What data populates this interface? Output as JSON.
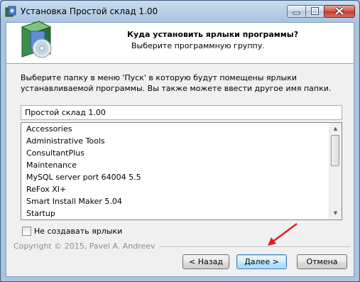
{
  "window": {
    "title": "Установка Простой склад 1.00"
  },
  "header": {
    "title": "Куда установить ярлыки программы?",
    "subtitle": "Выберите программную группу."
  },
  "description": "Выберите папку в меню 'Пуск' в которую будут помещены ярлыки устанавливаемой программы. Вы также можете ввести другое имя папки.",
  "folder_input": {
    "value": "Простой склад 1.00"
  },
  "folders": [
    "Accessories",
    "Administrative Tools",
    "ConsultantPlus",
    "Maintenance",
    "MySQL server port 64004 5.5",
    "ReFox XI+",
    "Smart Install Maker 5.04",
    "Startup"
  ],
  "no_shortcuts": {
    "label": "Не создавать ярлыки",
    "checked": false
  },
  "copyright": "Copyright © 2015, Pavel A. Andreev",
  "buttons": {
    "back": "< Назад",
    "next": "Далее >",
    "cancel": "Отмена"
  },
  "colors": {
    "annotation_arrow": "#e02020",
    "default_button_border": "#3c7fb1"
  },
  "icons": {
    "app": "setup-icon",
    "header_image": "software-box-cd-icon",
    "scroll_up": "arrow-up-icon",
    "scroll_down": "arrow-down-icon"
  }
}
